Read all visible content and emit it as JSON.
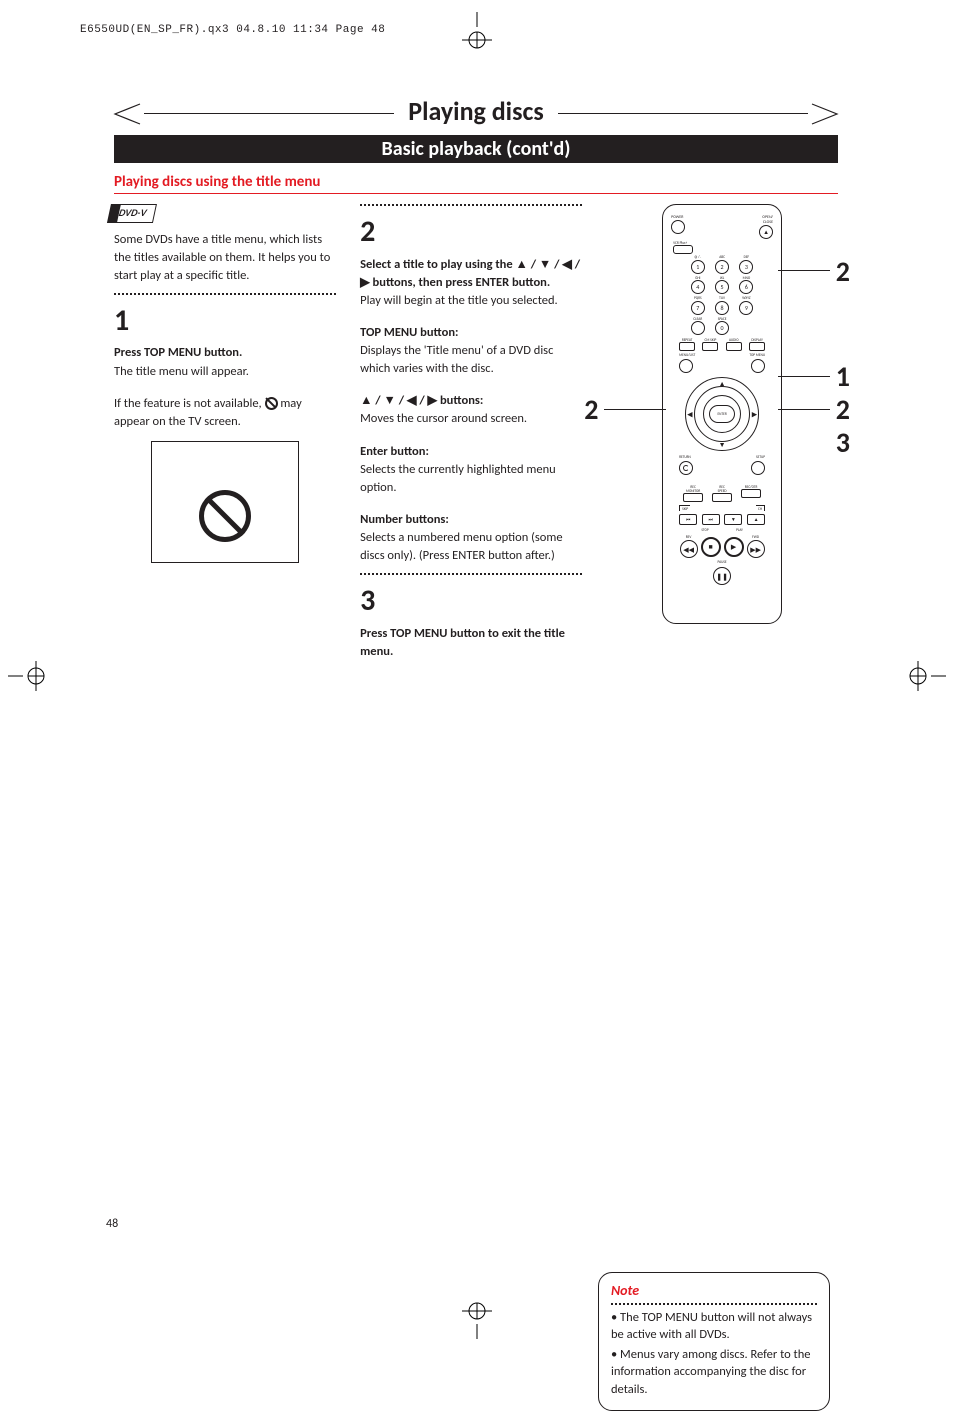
{
  "header_line": "E6550UD(EN_SP_FR).qx3  04.8.10  11:34  Page 48",
  "page_number": "48",
  "title": "Playing discs",
  "subtitle": "Basic playback (cont'd)",
  "section": "Playing discs using the title menu",
  "dvd_badge": "DVD-V",
  "col1": {
    "intro": "Some DVDs have a title menu, which lists the titles available on them. It helps you to start play at a specific title.",
    "step1_num": "1",
    "step1_head": "Press TOP MENU button.",
    "step1_body": "The title menu will appear.",
    "step1_body2a": "If the feature is not available, ",
    "step1_body2b": " may appear on the TV screen."
  },
  "col2": {
    "step2_num": "2",
    "step2_head": "Select a title to play using the ▲ / ▼ / ◀ / ▶ buttons, then press ENTER button.",
    "step2_body": "Play will begin at the title you selected.",
    "topmenu_head": "TOP MENU button:",
    "topmenu_body": "Displays the 'Title menu' of a DVD disc which varies with the disc.",
    "arrows_head": "▲ / ▼ / ◀ / ▶ buttons:",
    "arrows_body": "Moves the cursor around screen.",
    "enter_head": "Enter button:",
    "enter_body": "Selects the currently highlighted menu option.",
    "number_head": "Number buttons:",
    "number_body": "Selects a numbered menu option (some discs only). (Press ENTER button after.)",
    "step3_num": "3",
    "step3_head": "Press TOP MENU button to exit the title menu."
  },
  "remote": {
    "power": "POWER",
    "open": "OPEN/\nCLOSE",
    "vcr": "VCR Plus+",
    "num_labels": [
      "@ / .",
      "ABC",
      "DEF",
      "GHI",
      "JKL",
      "MNO",
      "PQRS",
      "TUV",
      "WXYZ",
      "CLEAR",
      "SPACE",
      ""
    ],
    "nums": [
      "1",
      "2",
      "3",
      "4",
      "5",
      "6",
      "7",
      "8",
      "9",
      "",
      "0",
      ""
    ],
    "row4": [
      "REPEAT",
      "CM SKIP",
      "AUDIO",
      "DISPLAY"
    ],
    "menu_left": "MENU/LIST",
    "menu_right": "TOP MENU",
    "enter": "ENTER",
    "return": "RETURN",
    "setup": "SETUP",
    "rec": [
      "REC\nMONITOR",
      "REC\nSPEED",
      "REC/OTR"
    ],
    "skip_l": "SKIP",
    "ch": "CH",
    "stop": "STOP",
    "play": "PLAY",
    "rev": "REV",
    "fwd": "FWD",
    "pause": "PAUSE"
  },
  "callouts": {
    "c2_top": "2",
    "c1": "1",
    "c2_mid": "2",
    "c3": "3",
    "c2_left": "2"
  },
  "note": {
    "head": "Note",
    "b1": "The TOP MENU button will not always be active with all DVDs.",
    "b2": "Menus vary among discs. Refer to the information accompanying the disc for details."
  }
}
